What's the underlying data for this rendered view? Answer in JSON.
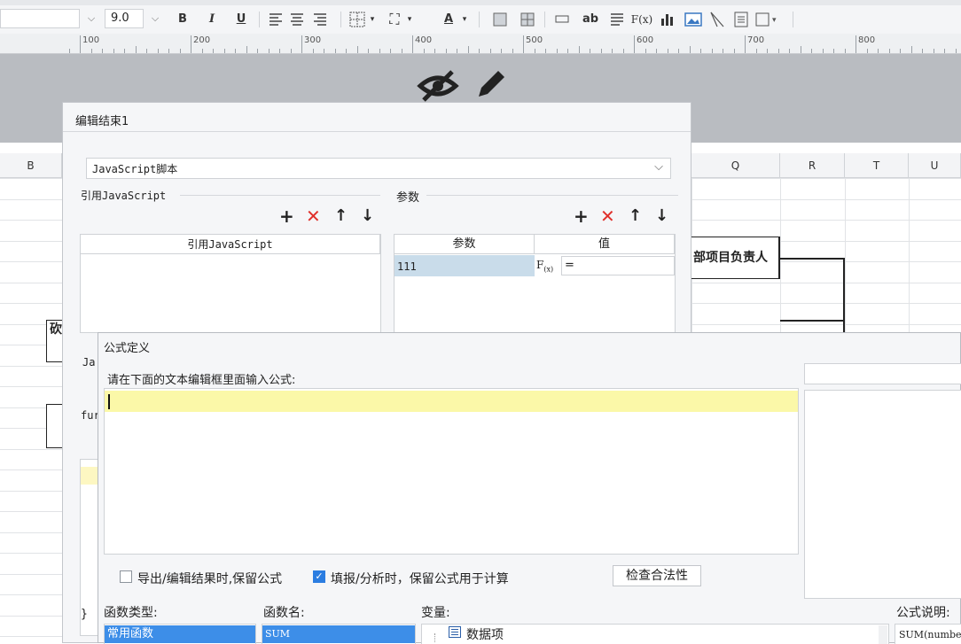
{
  "toolbar": {
    "font_size": "9.0",
    "bold": "B",
    "italic": "I",
    "underline": "U",
    "text_color_glyph": "A",
    "text_widget": "ab",
    "formula_glyph": "F(x)"
  },
  "ruler": {
    "labels": [
      "100",
      "200",
      "300",
      "400",
      "500",
      "600",
      "700",
      "800"
    ]
  },
  "sheet": {
    "columns_left": [
      "B"
    ],
    "columns_right": [
      "Q",
      "R",
      "T",
      "U"
    ],
    "cell_text": "部项目负责人",
    "left_cell_fragment": "砍"
  },
  "js_dialog": {
    "title": "编辑结束1",
    "type_select": "JavaScript脚本",
    "ref_label": "引用JavaScript",
    "ref_column": "引用JavaScript",
    "params_label": "参数",
    "params_columns": {
      "name": "参数",
      "value": "值"
    },
    "param_row": {
      "name": "111",
      "value": "="
    },
    "js_fragment": "Ja",
    "fn_fragment": "fur",
    "brace_fragment": "}"
  },
  "formula_dialog": {
    "title": "公式定义",
    "prompt": "请在下面的文本编辑框里面输入公式:",
    "opt_export": "导出/编辑结果时,保留公式",
    "opt_fill": "填报/分析时，保留公式用于计算",
    "check_button": "检查合法性",
    "fn_type_label": "函数类型:",
    "fn_name_label": "函数名:",
    "var_label": "变量:",
    "desc_label": "公式说明:",
    "fn_type_selected": "常用函数",
    "fn_name_selected": "SUM",
    "var_item": "数据项",
    "desc_text": "SUM(number"
  }
}
